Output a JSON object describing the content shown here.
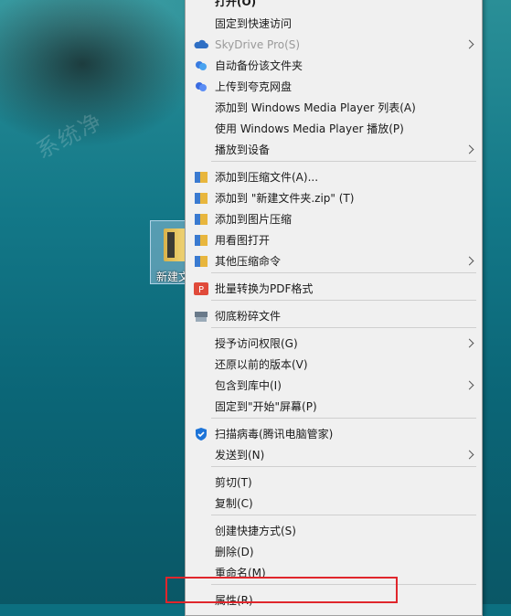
{
  "desktop": {
    "icon_label": "新建文",
    "watermark": "系统净"
  },
  "menu": {
    "items": [
      {
        "label": "打开(O)",
        "icon": "",
        "arrow": false,
        "disabled": false
      },
      {
        "label": "固定到快速访问",
        "icon": "",
        "arrow": false,
        "disabled": false
      },
      {
        "label": "SkyDrive Pro(S)",
        "icon": "skydrive-cloud-icon",
        "arrow": true,
        "disabled": true
      },
      {
        "label": "自动备份该文件夹",
        "icon": "baidu-cloud-icon",
        "arrow": false,
        "disabled": false
      },
      {
        "label": "上传到夸克网盘",
        "icon": "quark-cloud-icon",
        "arrow": false,
        "disabled": false
      },
      {
        "label": "添加到 Windows Media Player 列表(A)",
        "icon": "",
        "arrow": false,
        "disabled": false
      },
      {
        "label": "使用 Windows Media Player 播放(P)",
        "icon": "",
        "arrow": false,
        "disabled": false
      },
      {
        "label": "播放到设备",
        "icon": "",
        "arrow": true,
        "disabled": false
      },
      {
        "label": "添加到压缩文件(A)...",
        "icon": "archive-icon",
        "arrow": false,
        "disabled": false
      },
      {
        "label": "添加到 \"新建文件夹.zip\" (T)",
        "icon": "archive-icon",
        "arrow": false,
        "disabled": false
      },
      {
        "label": "添加到图片压缩",
        "icon": "archive-icon",
        "arrow": false,
        "disabled": false
      },
      {
        "label": "用看图打开",
        "icon": "archive-icon",
        "arrow": false,
        "disabled": false
      },
      {
        "label": "其他压缩命令",
        "icon": "archive-icon",
        "arrow": true,
        "disabled": false
      },
      {
        "label": "批量转换为PDF格式",
        "icon": "pdf-convert-icon",
        "arrow": false,
        "disabled": false
      },
      {
        "label": "彻底粉碎文件",
        "icon": "shredder-icon",
        "arrow": false,
        "disabled": false
      },
      {
        "label": "授予访问权限(G)",
        "icon": "",
        "arrow": true,
        "disabled": false
      },
      {
        "label": "还原以前的版本(V)",
        "icon": "",
        "arrow": false,
        "disabled": false
      },
      {
        "label": "包含到库中(I)",
        "icon": "",
        "arrow": true,
        "disabled": false
      },
      {
        "label": "固定到\"开始\"屏幕(P)",
        "icon": "",
        "arrow": false,
        "disabled": false
      },
      {
        "label": "扫描病毒(腾讯电脑管家)",
        "icon": "shield-icon",
        "arrow": false,
        "disabled": false
      },
      {
        "label": "发送到(N)",
        "icon": "",
        "arrow": true,
        "disabled": false
      },
      {
        "label": "剪切(T)",
        "icon": "",
        "arrow": false,
        "disabled": false
      },
      {
        "label": "复制(C)",
        "icon": "",
        "arrow": false,
        "disabled": false
      },
      {
        "label": "创建快捷方式(S)",
        "icon": "",
        "arrow": false,
        "disabled": false
      },
      {
        "label": "删除(D)",
        "icon": "",
        "arrow": false,
        "disabled": false
      },
      {
        "label": "重命名(M)",
        "icon": "",
        "arrow": false,
        "disabled": false
      },
      {
        "label": "属性(R)",
        "icon": "",
        "arrow": false,
        "disabled": false
      }
    ]
  },
  "colors": {
    "menu_bg": "#f0f0f0",
    "highlight_border": "#e0262c",
    "separator": "#cfcfcf"
  }
}
